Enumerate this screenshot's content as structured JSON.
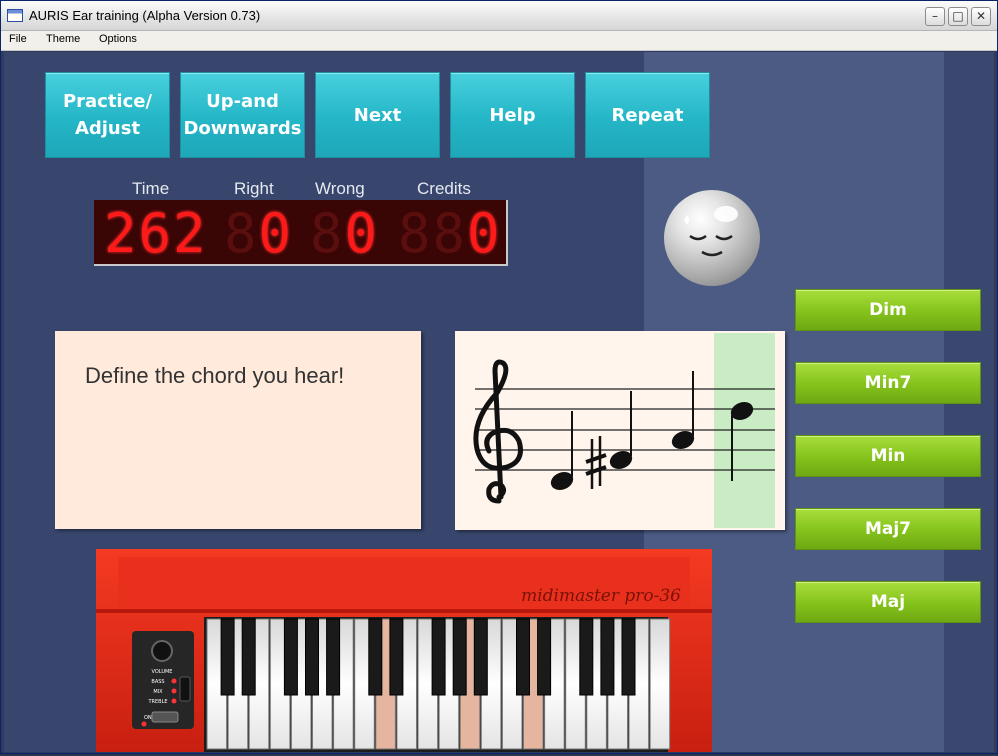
{
  "window": {
    "title": "AURIS Ear training (Alpha Version 0.73)",
    "controls": {
      "minimize": "–",
      "maximize": "□",
      "close": "✕"
    }
  },
  "menu": [
    "File",
    "Theme",
    "Options"
  ],
  "toolbar": [
    {
      "label": "Practice/\nAdjust"
    },
    {
      "label": "Up-and\nDownwards"
    },
    {
      "label": "Next"
    },
    {
      "label": "Help"
    },
    {
      "label": "Repeat"
    }
  ],
  "score": {
    "labels": {
      "time": "Time",
      "right": "Right",
      "wrong": "Wrong",
      "credits": "Credits"
    },
    "time": "262",
    "right": "0",
    "wrong": "0",
    "credits": "0"
  },
  "prompt": "Define the chord you hear!",
  "answers": [
    "Dim",
    "Min7",
    "Min",
    "Maj7",
    "Maj"
  ],
  "keyboard": {
    "brand": "midimaster pro-36",
    "knob_label": "VOLUME",
    "switches": [
      "BASS",
      "MIX",
      "TREBLE"
    ],
    "power": "ON"
  },
  "colors": {
    "toolbar_button": "#24b6c7",
    "answer_button": "#84c21b",
    "led_on": "#ff1a1a",
    "keyboard_body": "#e0281b"
  }
}
